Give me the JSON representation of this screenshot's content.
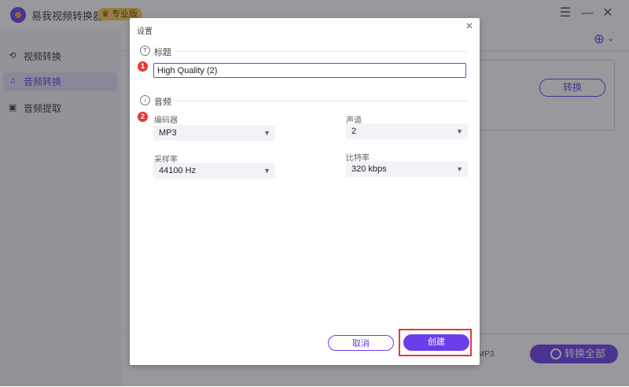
{
  "app": {
    "title": "易我视频转换器",
    "badge": "专业版",
    "window_controls": [
      "menu-icon",
      "minimize-icon",
      "close-icon"
    ]
  },
  "sidebar": {
    "items": [
      {
        "label": "视频转换",
        "icon": "video-convert-icon",
        "active": false
      },
      {
        "label": "音频转换",
        "icon": "audio-convert-icon",
        "active": true
      },
      {
        "label": "音频提取",
        "icon": "audio-extract-icon",
        "active": false
      }
    ]
  },
  "main": {
    "convert_label": "转换",
    "convert_all_label": "转换全部",
    "format_tag": "MP3"
  },
  "dialog": {
    "title": "设置",
    "close_icon": "close-icon",
    "title_section": {
      "label": "标题",
      "icon": "text-icon",
      "marker": "1",
      "value": "High Quality (2)"
    },
    "audio_section": {
      "label": "音频",
      "icon": "music-note-icon",
      "marker": "2",
      "fields": {
        "encoder": {
          "label": "编码器",
          "value": "MP3"
        },
        "channel": {
          "label": "声道",
          "value": "2"
        },
        "sample_rate": {
          "label": "采样率",
          "value": "44100 Hz"
        },
        "bitrate": {
          "label": "比特率",
          "value": "320 kbps"
        }
      }
    },
    "buttons": {
      "cancel": "取消",
      "create": "创建"
    }
  },
  "colors": {
    "accent": "#6a3ee8",
    "highlight": "#e53935",
    "badge": "#f9cf4e"
  }
}
